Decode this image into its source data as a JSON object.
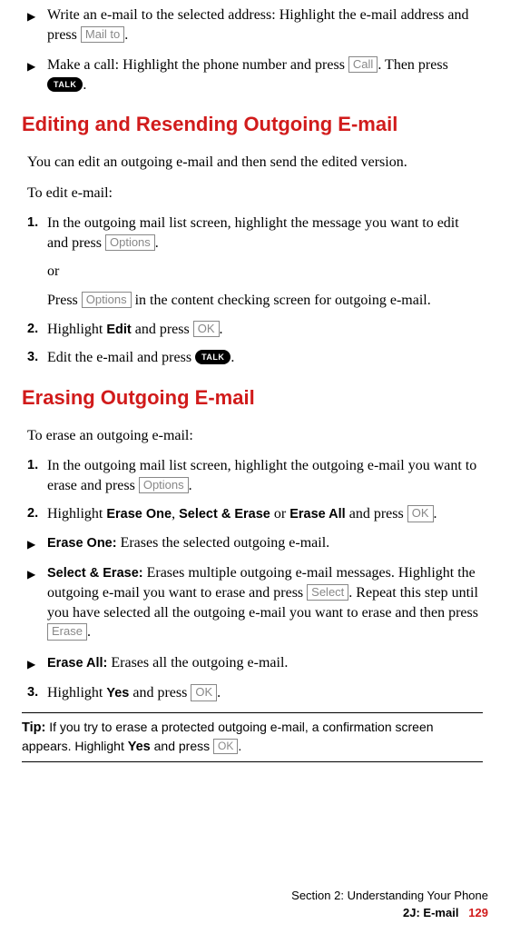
{
  "btn": {
    "mailTo": "Mail to",
    "call": "Call",
    "talk": "TALK",
    "options": "Options",
    "ok": "OK",
    "select": "Select",
    "erase": "Erase"
  },
  "top": {
    "b1a": "Write an e-mail to the selected address: Highlight the e-mail address and press ",
    "b1b": ".",
    "b2a": "Make a call: Highlight the phone number and press ",
    "b2b": ". Then press ",
    "b2c": "."
  },
  "editing": {
    "heading": "Editing and Resending Outgoing E-mail",
    "p1": "You can edit an outgoing e-mail and then send the edited version.",
    "p2": "To edit e-mail:",
    "s1a": "In the outgoing mail list screen, highlight the message you want to edit and press ",
    "s1b": ".",
    "or": "or",
    "s1c": "Press ",
    "s1d": " in the content checking screen for outgoing e-mail.",
    "s2a": "Highlight ",
    "s2bold": "Edit",
    "s2b": " and press ",
    "s2c": ".",
    "s3a": "Edit the e-mail and press ",
    "s3b": "."
  },
  "erasing": {
    "heading": "Erasing Outgoing E-mail",
    "p1": "To erase an outgoing e-mail:",
    "s1a": "In the outgoing mail list screen, highlight the outgoing e-mail you want to erase and press ",
    "s1b": ".",
    "s2a": "Highlight ",
    "s2b1": "Erase One",
    "s2b": ", ",
    "s2b2": "Select & Erase",
    "s2c": " or ",
    "s2b3": "Erase All",
    "s2d": " and press ",
    "s2e": ".",
    "eb1t": "Erase One:",
    "eb1": " Erases the selected outgoing e-mail.",
    "eb2t": "Select & Erase:",
    "eb2a": " Erases multiple outgoing e-mail messages. Highlight the outgoing e-mail you want to erase and press ",
    "eb2b": ". Repeat this step until you have selected all the outgoing e-mail you want to erase and then press ",
    "eb2c": ".",
    "eb3t": "Erase All:",
    "eb3": " Erases all the outgoing e-mail.",
    "s3a": "Highlight ",
    "s3bold": "Yes",
    "s3b": " and press ",
    "s3c": "."
  },
  "tip": {
    "label": "Tip:",
    "t1": " If you try to erase a protected outgoing e-mail, a confirmation screen appears. Highlight ",
    "t2bold": "Yes",
    "t2": " and press ",
    "t3": "."
  },
  "footer": {
    "line1": "Section 2: Understanding Your Phone",
    "line2a": "2J: E-mail",
    "page": "129"
  }
}
